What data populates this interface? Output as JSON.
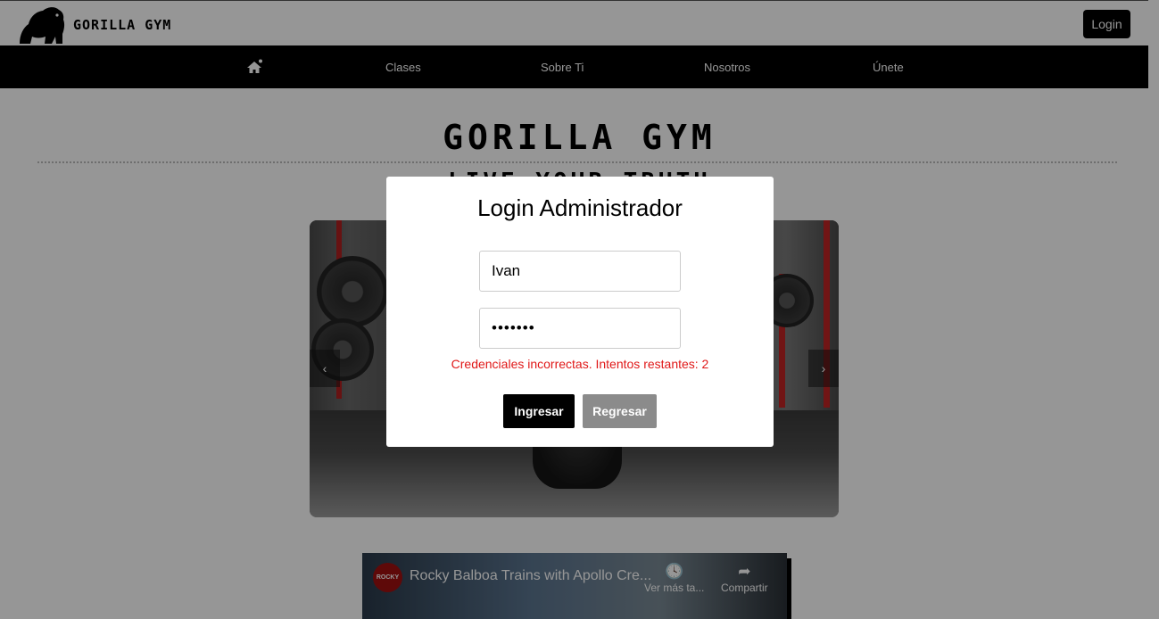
{
  "header": {
    "brand_name": "GORILLA GYM",
    "login_label": "Login"
  },
  "nav": {
    "home_icon": "home-icon",
    "items": [
      {
        "label": "Clases"
      },
      {
        "label": "Sobre Ti"
      },
      {
        "label": "Nosotros"
      },
      {
        "label": "Únete"
      }
    ]
  },
  "main": {
    "title": "GORILLA GYM",
    "subtitle": "LIVE YOUR TRUTH",
    "carousel": {
      "prev_label": "‹",
      "next_label": "›"
    },
    "video": {
      "channel_logo_text": "ROCKY",
      "title": "Rocky Balboa Trains with Apollo Cre...",
      "watch_later_label": "Ver más ta...",
      "share_label": "Compartir"
    }
  },
  "modal": {
    "title": "Login Administrador",
    "username_value": "Ivan",
    "password_value": "•••••••",
    "error": "Credenciales incorrectas. Intentos restantes: 2",
    "submit_label": "Ingresar",
    "back_label": "Regresar"
  },
  "colors": {
    "nav_bg": "#000000",
    "error": "#e01818",
    "back_button": "#8b8b8b"
  }
}
